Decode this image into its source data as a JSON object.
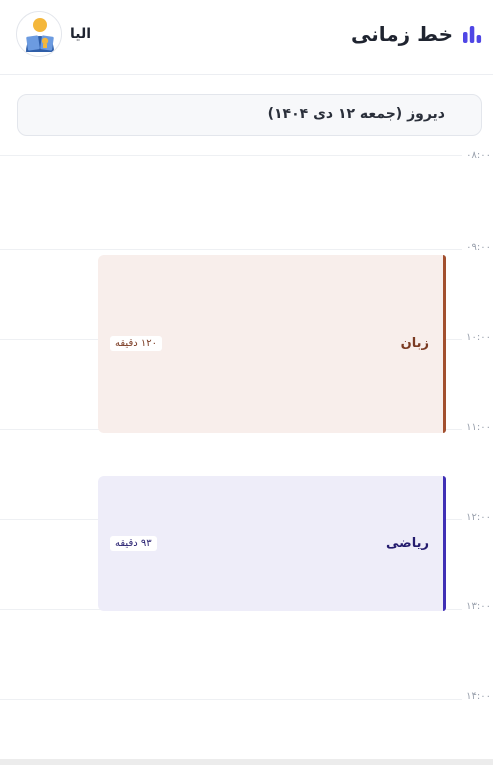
{
  "header": {
    "title": "خط زمانی",
    "title_icon": "bar-chart-icon",
    "user_name": "الیا",
    "avatar_icon": "student-reading-avatar"
  },
  "date_selector": {
    "label": "دیروز (جمعه ۱۲ دی ۱۴۰۴)"
  },
  "timeline": {
    "hours": [
      "۰۸:۰۰",
      "۰۹:۰۰",
      "۱۰:۰۰",
      "۱۱:۰۰",
      "۱۲:۰۰",
      "۱۳:۰۰",
      "۱۴:۰۰"
    ],
    "events": [
      {
        "name": "زبان",
        "duration_label": "۱۲۰ دقیقه",
        "accent": "#a24f2e",
        "background": "#f8eeeb"
      },
      {
        "name": "ریاضی",
        "duration_label": "۹۳ دقیقه",
        "accent": "#3f2fb5",
        "background": "#eeedf9"
      }
    ]
  },
  "colors": {
    "primary": "#4f46e5",
    "grid": "#eef0f3",
    "hour_text": "#9aa1ad"
  }
}
